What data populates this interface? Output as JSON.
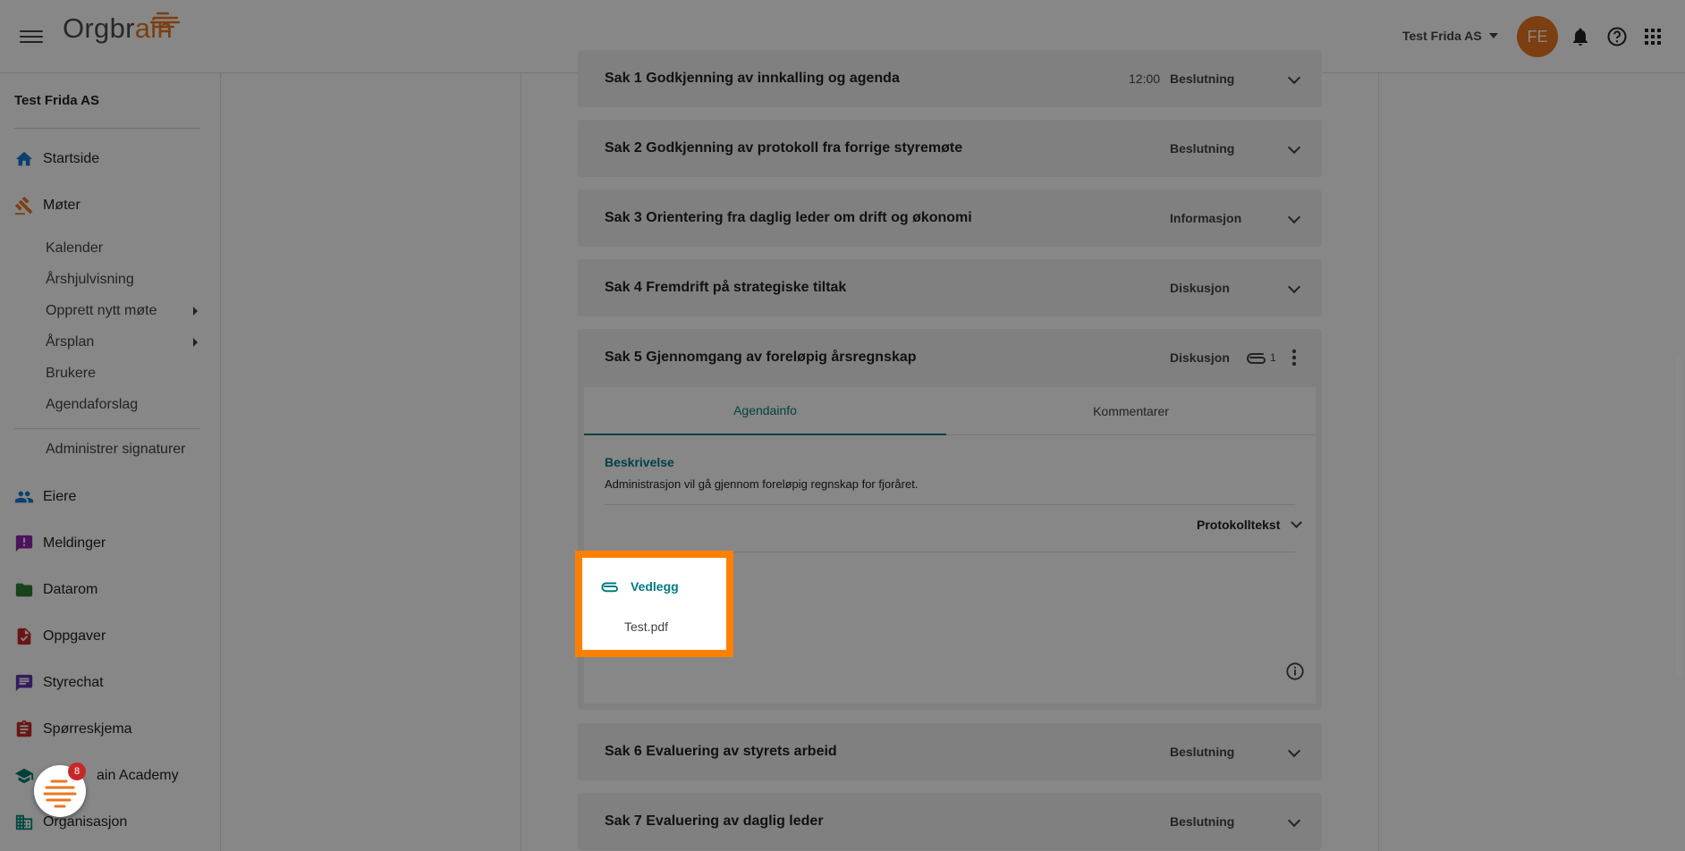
{
  "header": {
    "logo_text_a": "Orgbr",
    "logo_text_b": "ain",
    "org_name": "Test Frida AS",
    "avatar_initials": "FE"
  },
  "sidebar": {
    "org_title": "Test Frida AS",
    "items": [
      {
        "label": "Startside",
        "icon": "home-icon"
      },
      {
        "label": "Møter",
        "icon": "gavel-icon"
      },
      {
        "label": "Eiere",
        "icon": "people-icon"
      },
      {
        "label": "Meldinger",
        "icon": "message-alert-icon"
      },
      {
        "label": "Datarom",
        "icon": "folder-icon"
      },
      {
        "label": "Oppgaver",
        "icon": "task-icon"
      },
      {
        "label": "Styrechat",
        "icon": "chat-icon"
      },
      {
        "label": "Spørreskjema",
        "icon": "clipboard-icon"
      },
      {
        "label": "ain Academy",
        "icon": "school-icon"
      },
      {
        "label": "Organisasjon",
        "icon": "organization-icon"
      }
    ],
    "sub_items": [
      "Kalender",
      "Årshjulvisning",
      "Opprett nytt møte",
      "Årsplan",
      "Brukere",
      "Agendaforslag",
      "Administrer signaturer"
    ],
    "notification_count": "8"
  },
  "agenda": [
    {
      "title": "Sak 1 Godkjenning av innkalling og agenda",
      "time": "12:00",
      "type": "Beslutning"
    },
    {
      "title": "Sak 2 Godkjenning av protokoll fra forrige styremøte",
      "type": "Beslutning"
    },
    {
      "title": "Sak 3 Orientering fra daglig leder om drift og økonomi",
      "type": "Informasjon"
    },
    {
      "title": "Sak 4 Fremdrift på strategiske tiltak",
      "type": "Diskusjon"
    },
    {
      "title": "Sak 5 Gjennomgang av foreløpig årsregnskap",
      "type": "Diskusjon",
      "attachment_count": "1"
    },
    {
      "title": "Sak 6 Evaluering av styrets arbeid",
      "type": "Beslutning"
    },
    {
      "title": "Sak 7 Evaluering av daglig leder",
      "type": "Beslutning"
    }
  ],
  "expanded": {
    "tabs": [
      "Agendainfo",
      "Kommentarer"
    ],
    "description_label": "Beskrivelse",
    "description_text": "Administrasjon vil gå gjennom foreløpig regnskap for fjoråret.",
    "protocol_label": "Protokolltekst",
    "attachments_label": "Vedlegg",
    "attachment_file": "Test.pdf"
  },
  "colors": {
    "accent": "#007b83",
    "brand": "#e87722",
    "highlight": "#ff8000"
  }
}
